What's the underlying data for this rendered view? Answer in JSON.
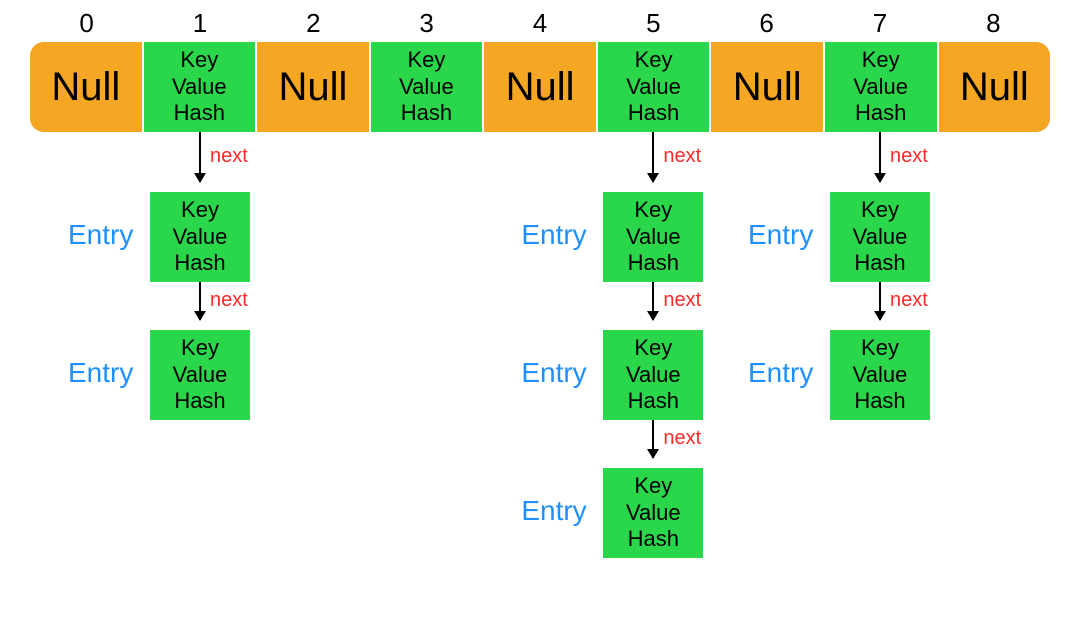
{
  "indices": [
    "0",
    "1",
    "2",
    "3",
    "4",
    "5",
    "6",
    "7",
    "8"
  ],
  "null_text": "Null",
  "node_lines": [
    "Key",
    "Value",
    "Hash"
  ],
  "entry_label": "Entry",
  "next_label": "next",
  "buckets": [
    {
      "i": 0,
      "type": "null"
    },
    {
      "i": 1,
      "type": "entry",
      "chain": 2
    },
    {
      "i": 2,
      "type": "null"
    },
    {
      "i": 3,
      "type": "entry",
      "chain": 0
    },
    {
      "i": 4,
      "type": "null"
    },
    {
      "i": 5,
      "type": "entry",
      "chain": 3
    },
    {
      "i": 6,
      "type": "null"
    },
    {
      "i": 7,
      "type": "entry",
      "chain": 2
    },
    {
      "i": 8,
      "type": "null"
    }
  ],
  "colors": {
    "null_bg": "#f5a623",
    "entry_bg": "#2ad64a",
    "entry_label": "#1e90ff",
    "next_label": "#ff2a2a"
  }
}
